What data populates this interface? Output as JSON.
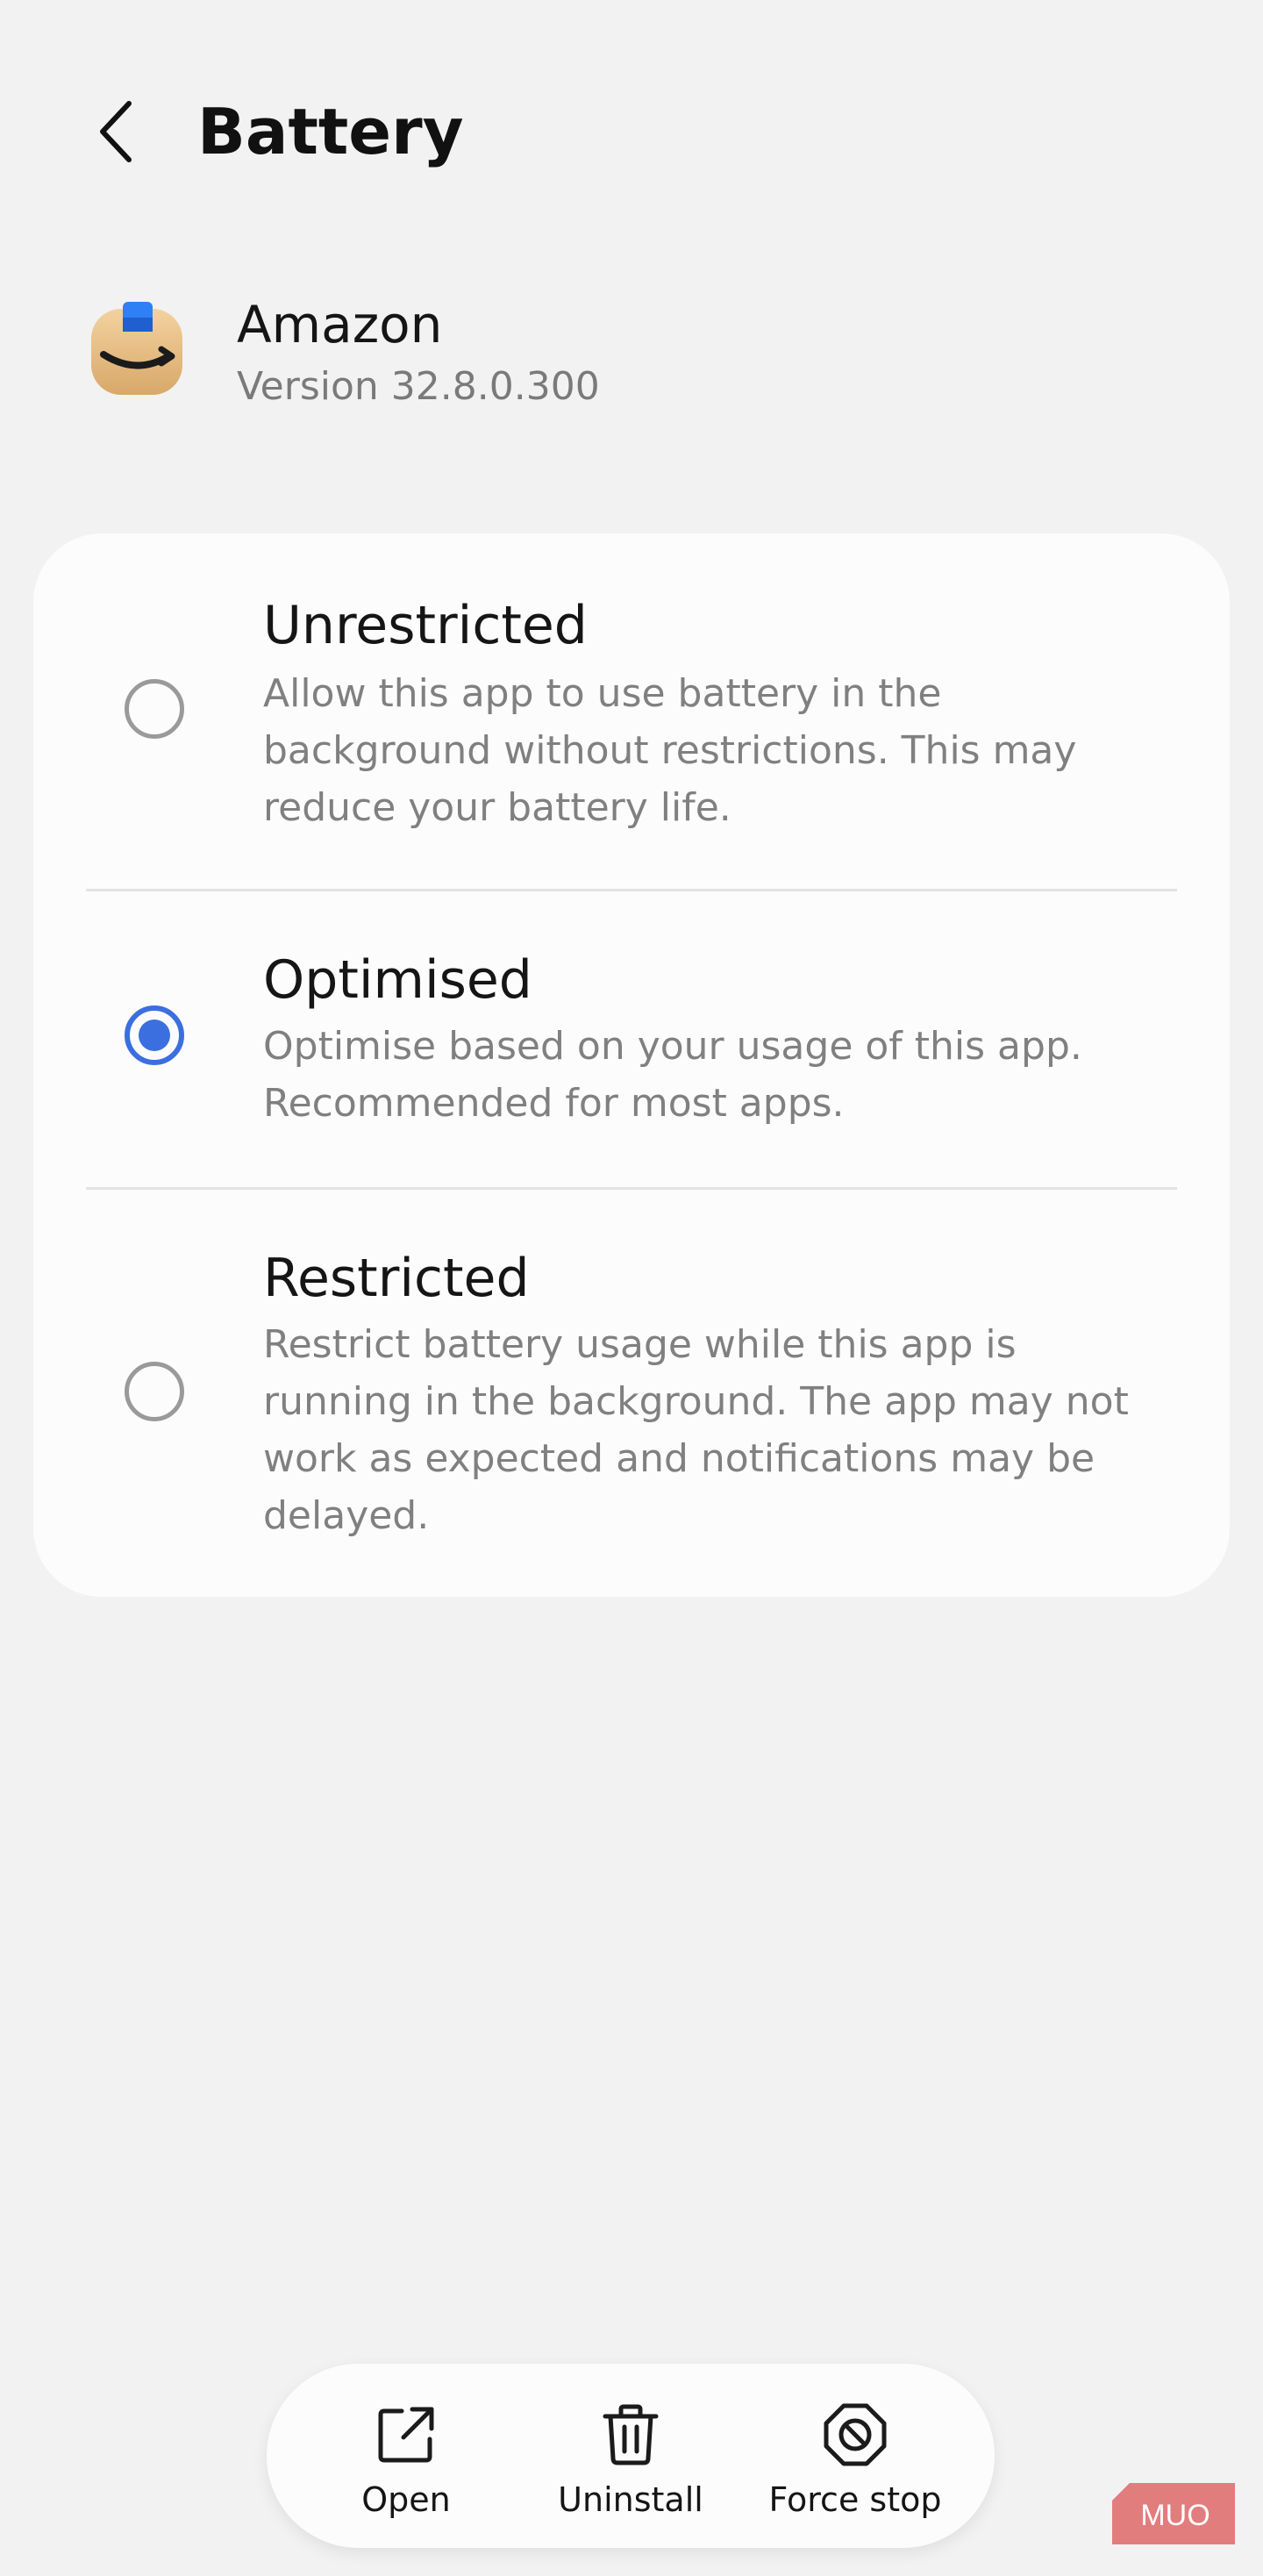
{
  "header": {
    "title": "Battery",
    "back_icon": "chevron-left-icon"
  },
  "app": {
    "name": "Amazon",
    "version": "Version 32.8.0.300",
    "icon": "amazon-app-icon"
  },
  "battery_options": [
    {
      "title": "Unrestricted",
      "description": "Allow this app to use battery in the background without restrictions. This may reduce your battery life.",
      "selected": false
    },
    {
      "title": "Optimised",
      "description": "Optimise based on your usage of this app. Recommended for most apps.",
      "selected": true
    },
    {
      "title": "Restricted",
      "description": "Restrict battery usage while this app is running in the background. The app may not work as expected and notifications may be delayed.",
      "selected": false
    }
  ],
  "actions": {
    "open": {
      "label": "Open",
      "icon": "open-external-icon"
    },
    "uninstall": {
      "label": "Uninstall",
      "icon": "trash-icon"
    },
    "force_stop": {
      "label": "Force stop",
      "icon": "force-stop-icon"
    }
  },
  "watermark": {
    "text": "MUO"
  },
  "colors": {
    "background": "#f2f2f3",
    "card": "#fcfcfc",
    "accent": "#3b6fe0",
    "secondary_text": "#808080",
    "watermark": "#e06666"
  }
}
